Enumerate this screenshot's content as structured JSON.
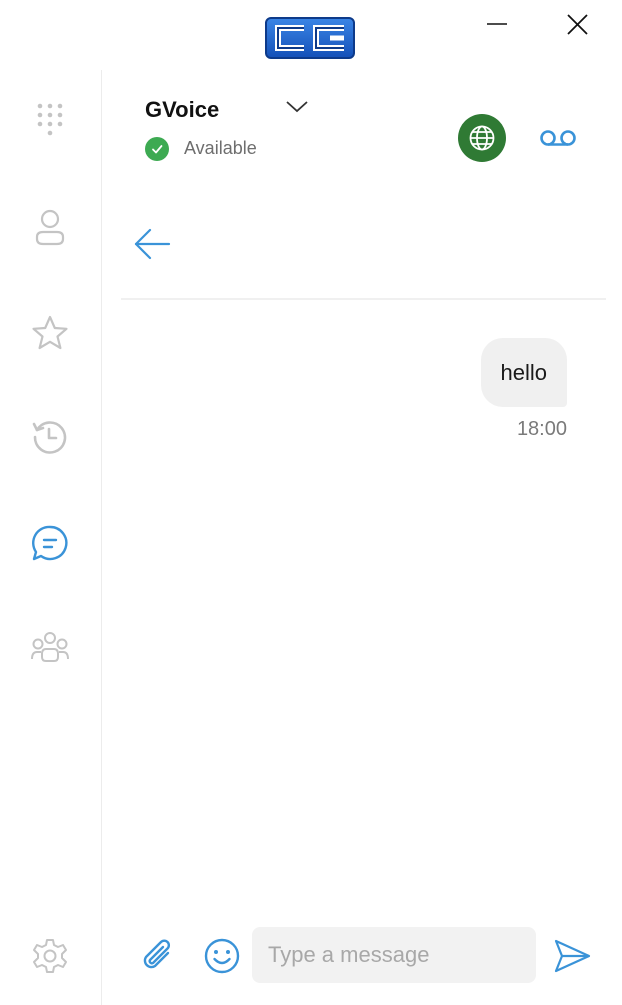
{
  "app": {
    "logo_text": "CC",
    "accent_color": "#3a93d8",
    "logo_colors": [
      "#2a6fd0",
      "#0d3a8a"
    ]
  },
  "window_controls": {
    "minimize_icon": "minimize-icon",
    "close_icon": "close-icon"
  },
  "sidebar": {
    "items": [
      {
        "name": "dialpad",
        "icon": "dialpad-icon",
        "active": false
      },
      {
        "name": "contacts",
        "icon": "person-icon",
        "active": false
      },
      {
        "name": "favorites",
        "icon": "star-icon",
        "active": false
      },
      {
        "name": "history",
        "icon": "history-icon",
        "active": false
      },
      {
        "name": "chat",
        "icon": "chat-icon",
        "active": true
      },
      {
        "name": "groups",
        "icon": "group-icon",
        "active": false
      },
      {
        "name": "settings",
        "icon": "gear-icon",
        "active": false
      }
    ]
  },
  "header": {
    "account_name": "GVoice",
    "status_label": "Available",
    "status_color": "#3daa52",
    "globe_color": "#2f7a34"
  },
  "conversation": {
    "messages": [
      {
        "text": "hello",
        "time": "18:00",
        "outgoing": true
      }
    ]
  },
  "composer": {
    "placeholder": "Type a message",
    "value": ""
  }
}
